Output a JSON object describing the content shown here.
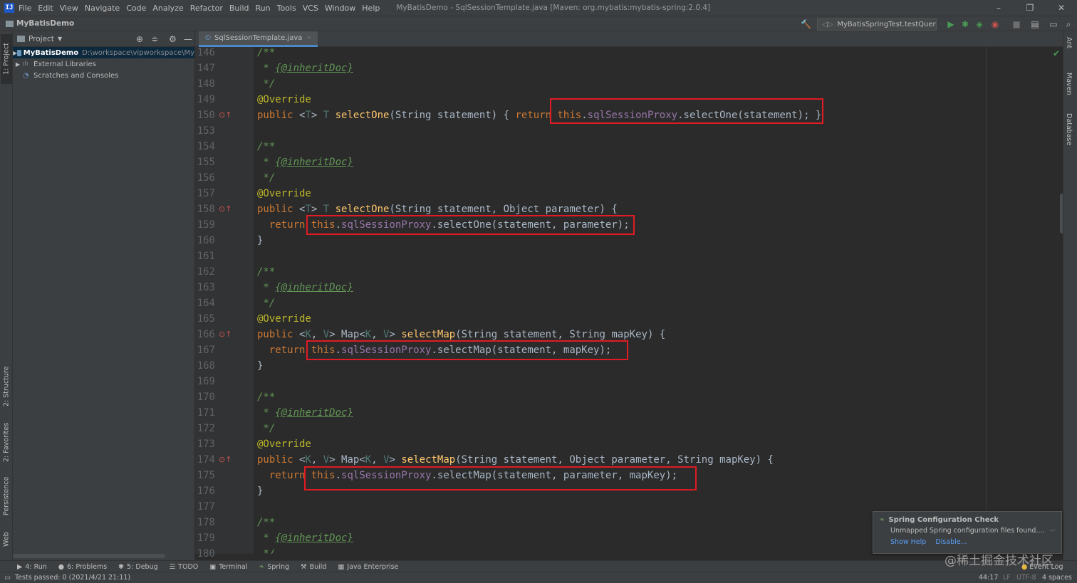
{
  "menubar": {
    "items": [
      "File",
      "Edit",
      "View",
      "Navigate",
      "Code",
      "Analyze",
      "Refactor",
      "Build",
      "Run",
      "Tools",
      "VCS",
      "Window",
      "Help"
    ],
    "title": "MyBatisDemo - SqlSessionTemplate.java [Maven: org.mybatis:mybatis-spring:2.0.4]"
  },
  "navbar": {
    "project": "MyBatisDemo",
    "run_config": "MyBatisSpringTest.testQuery"
  },
  "left_tabs": [
    "1: Project",
    "2: Structure",
    "2: Favorites",
    "Persistence",
    "Web"
  ],
  "right_tabs": [
    "Ant",
    "Maven",
    "Database"
  ],
  "project_panel": {
    "header": "Project",
    "tree": [
      {
        "name": "MyBatisDemo",
        "path": "D:\\workspace\\vipworkspace\\My"
      },
      {
        "name": "External Libraries"
      },
      {
        "name": "Scratches and Consoles"
      }
    ]
  },
  "editor": {
    "tab": "SqlSessionTemplate.java",
    "lines": [
      {
        "n": "146",
        "t": [
          [
            "cm",
            "/**"
          ]
        ]
      },
      {
        "n": "147",
        "t": [
          [
            "cm",
            " * "
          ],
          [
            "doc",
            "{@inheritDoc}"
          ]
        ]
      },
      {
        "n": "148",
        "t": [
          [
            "cm",
            " */"
          ]
        ]
      },
      {
        "n": "149",
        "t": [
          [
            "ann",
            "@Override"
          ]
        ]
      },
      {
        "n": "150",
        "t": [
          [
            "kw",
            "public "
          ],
          [
            "pl",
            "<"
          ],
          [
            "tp",
            "T"
          ],
          [
            "pl",
            "> "
          ],
          [
            "tp",
            "T "
          ],
          [
            "fn",
            "selectOne"
          ],
          [
            "pl",
            "(String statement) { "
          ],
          [
            "kw",
            "return "
          ],
          [
            "kw",
            "this"
          ],
          [
            "pl",
            "."
          ],
          [
            "fld",
            "sqlSessionProxy"
          ],
          [
            "pl",
            ".selectOne(statement); }"
          ]
        ]
      },
      {
        "n": "153",
        "t": []
      },
      {
        "n": "154",
        "t": [
          [
            "cm",
            "/**"
          ]
        ]
      },
      {
        "n": "155",
        "t": [
          [
            "cm",
            " * "
          ],
          [
            "doc",
            "{@inheritDoc}"
          ]
        ]
      },
      {
        "n": "156",
        "t": [
          [
            "cm",
            " */"
          ]
        ]
      },
      {
        "n": "157",
        "t": [
          [
            "ann",
            "@Override"
          ]
        ]
      },
      {
        "n": "158",
        "t": [
          [
            "kw",
            "public "
          ],
          [
            "pl",
            "<"
          ],
          [
            "tp",
            "T"
          ],
          [
            "pl",
            "> "
          ],
          [
            "tp",
            "T "
          ],
          [
            "fn",
            "selectOne"
          ],
          [
            "pl",
            "(String statement, Object parameter) {"
          ]
        ]
      },
      {
        "n": "159",
        "t": [
          [
            "pl",
            "  "
          ],
          [
            "kw",
            "return "
          ],
          [
            "kw",
            "this"
          ],
          [
            "pl",
            "."
          ],
          [
            "fld",
            "sqlSessionProxy"
          ],
          [
            "pl",
            ".selectOne(statement, parameter);"
          ]
        ]
      },
      {
        "n": "160",
        "t": [
          [
            "pl",
            "}"
          ]
        ]
      },
      {
        "n": "161",
        "t": []
      },
      {
        "n": "162",
        "t": [
          [
            "cm",
            "/**"
          ]
        ]
      },
      {
        "n": "163",
        "t": [
          [
            "cm",
            " * "
          ],
          [
            "doc",
            "{@inheritDoc}"
          ]
        ]
      },
      {
        "n": "164",
        "t": [
          [
            "cm",
            " */"
          ]
        ]
      },
      {
        "n": "165",
        "t": [
          [
            "ann",
            "@Override"
          ]
        ]
      },
      {
        "n": "166",
        "t": [
          [
            "kw",
            "public "
          ],
          [
            "pl",
            "<"
          ],
          [
            "tp",
            "K"
          ],
          [
            "pl",
            ", "
          ],
          [
            "tp",
            "V"
          ],
          [
            "pl",
            "> Map<"
          ],
          [
            "tp",
            "K"
          ],
          [
            "pl",
            ", "
          ],
          [
            "tp",
            "V"
          ],
          [
            "pl",
            "> "
          ],
          [
            "fn",
            "selectMap"
          ],
          [
            "pl",
            "(String statement, String mapKey) {"
          ]
        ]
      },
      {
        "n": "167",
        "t": [
          [
            "pl",
            "  "
          ],
          [
            "kw",
            "return "
          ],
          [
            "kw",
            "this"
          ],
          [
            "pl",
            "."
          ],
          [
            "fld",
            "sqlSessionProxy"
          ],
          [
            "pl",
            ".selectMap(statement, mapKey);"
          ]
        ]
      },
      {
        "n": "168",
        "t": [
          [
            "pl",
            "}"
          ]
        ]
      },
      {
        "n": "169",
        "t": []
      },
      {
        "n": "170",
        "t": [
          [
            "cm",
            "/**"
          ]
        ]
      },
      {
        "n": "171",
        "t": [
          [
            "cm",
            " * "
          ],
          [
            "doc",
            "{@inheritDoc}"
          ]
        ]
      },
      {
        "n": "172",
        "t": [
          [
            "cm",
            " */"
          ]
        ]
      },
      {
        "n": "173",
        "t": [
          [
            "ann",
            "@Override"
          ]
        ]
      },
      {
        "n": "174",
        "t": [
          [
            "kw",
            "public "
          ],
          [
            "pl",
            "<"
          ],
          [
            "tp",
            "K"
          ],
          [
            "pl",
            ", "
          ],
          [
            "tp",
            "V"
          ],
          [
            "pl",
            "> Map<"
          ],
          [
            "tp",
            "K"
          ],
          [
            "pl",
            ", "
          ],
          [
            "tp",
            "V"
          ],
          [
            "pl",
            "> "
          ],
          [
            "fn",
            "selectMap"
          ],
          [
            "pl",
            "(String statement, Object parameter, String mapKey) {"
          ]
        ]
      },
      {
        "n": "175",
        "t": [
          [
            "pl",
            "  "
          ],
          [
            "kw",
            "return "
          ],
          [
            "kw",
            "this"
          ],
          [
            "pl",
            "."
          ],
          [
            "fld",
            "sqlSessionProxy"
          ],
          [
            "pl",
            ".selectMap(statement, parameter, mapKey);"
          ]
        ]
      },
      {
        "n": "176",
        "t": [
          [
            "pl",
            "}"
          ]
        ]
      },
      {
        "n": "177",
        "t": []
      },
      {
        "n": "178",
        "t": [
          [
            "cm",
            "/**"
          ]
        ]
      },
      {
        "n": "179",
        "t": [
          [
            "cm",
            " * "
          ],
          [
            "doc",
            "{@inheritDoc}"
          ]
        ]
      },
      {
        "n": "180",
        "t": [
          [
            "cm",
            " */"
          ]
        ]
      }
    ]
  },
  "notification": {
    "title": "Spring Configuration Check",
    "body": "Unmapped Spring configuration files found....",
    "link1": "Show Help",
    "link2": "Disable..."
  },
  "bottom_tabs": [
    "4: Run",
    "6: Problems",
    "5: Debug",
    "TODO",
    "Terminal",
    "Spring",
    "Build",
    "Java Enterprise"
  ],
  "bottom_right": "Event Log",
  "status": {
    "left": "Tests passed: 0 (2021/4/21 21:11)",
    "position": "44:17",
    "line_sep": "LF",
    "encoding": "UTF-8",
    "indent": "4 spaces"
  },
  "watermark": "@稀土掘金技术社区",
  "colors": {
    "highlight_box": "#e01b24",
    "accent": "#4a88c7"
  }
}
